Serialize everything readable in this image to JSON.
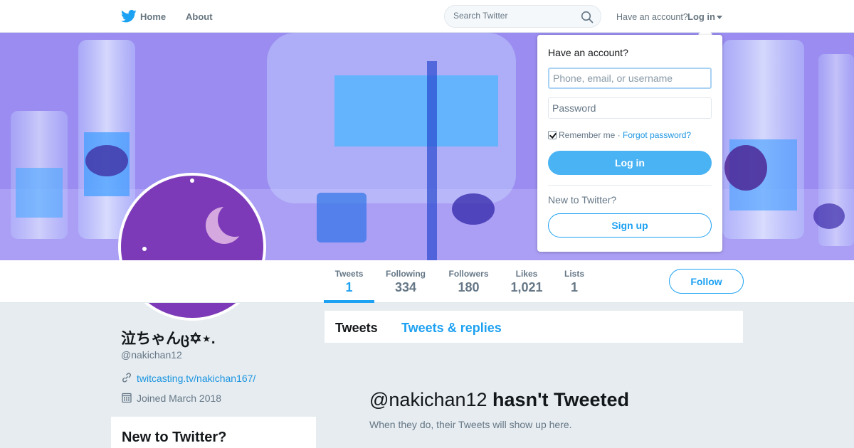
{
  "colors": {
    "accent": "#1da1f2",
    "link": "#1b95e0",
    "avatar_bg": "#7c3ab8"
  },
  "nav": {
    "home": "Home",
    "about": "About",
    "search_placeholder": "Search Twitter",
    "have_account": "Have an account?",
    "login": "Log in"
  },
  "login_dropdown": {
    "title": "Have an account?",
    "username_placeholder": "Phone, email, or username",
    "password_placeholder": "Password",
    "remember": "Remember me",
    "separator": "·",
    "forgot": "Forgot password?",
    "login_button": "Log in",
    "new_to_twitter": "New to Twitter?",
    "signup_button": "Sign up"
  },
  "stats": [
    {
      "label": "Tweets",
      "value": "1"
    },
    {
      "label": "Following",
      "value": "334"
    },
    {
      "label": "Followers",
      "value": "180"
    },
    {
      "label": "Likes",
      "value": "1,021"
    },
    {
      "label": "Lists",
      "value": "1"
    }
  ],
  "follow_button": "Follow",
  "profile": {
    "name": "泣ちゃんც✡⋆.",
    "handle": "@nakichan12",
    "link": "twitcasting.tv/nakichan167/",
    "joined": "Joined March 2018"
  },
  "new_card": {
    "title": "New to Twitter?"
  },
  "tabs": {
    "tweets": "Tweets",
    "replies": "Tweets & replies"
  },
  "empty": {
    "handle": "@nakichan12",
    "title_rest": "hasn't Tweeted",
    "sub": "When they do, their Tweets will show up here."
  }
}
